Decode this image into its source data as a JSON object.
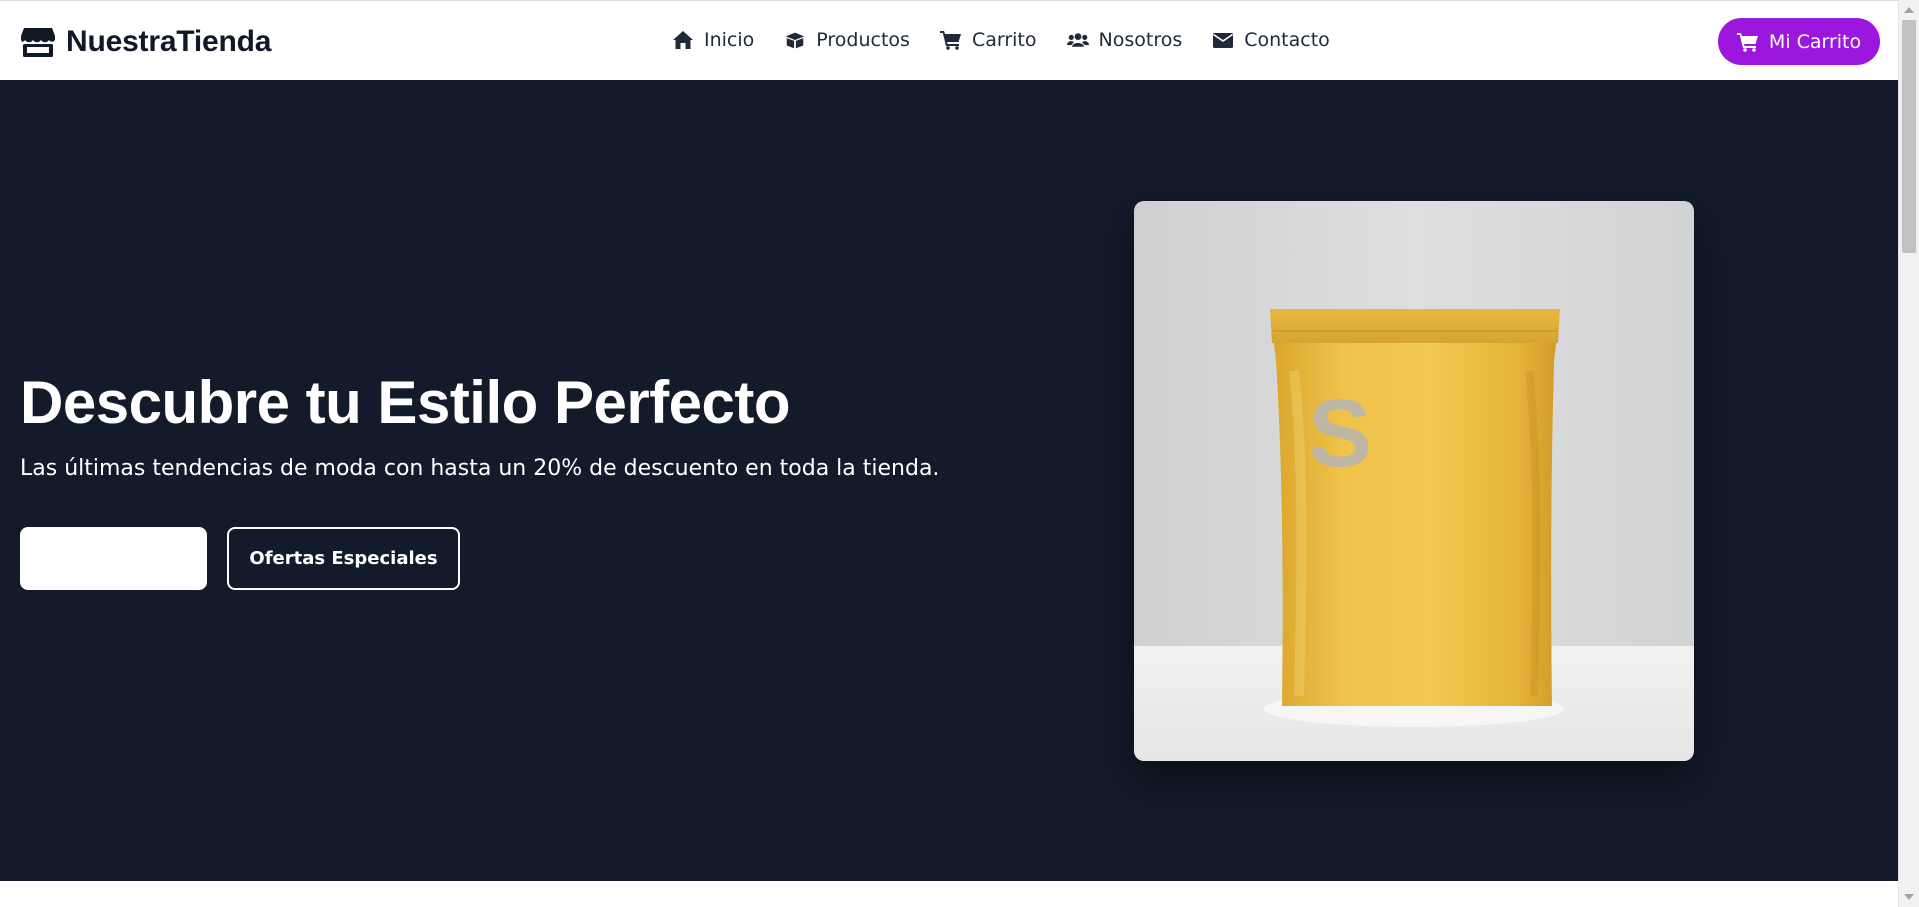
{
  "header": {
    "brand": "NuestraTienda",
    "brand_icon": "store-icon",
    "nav": [
      {
        "label": "Inicio",
        "icon": "home-icon"
      },
      {
        "label": "Productos",
        "icon": "box-icon"
      },
      {
        "label": "Carrito",
        "icon": "cart-icon"
      },
      {
        "label": "Nosotros",
        "icon": "users-icon"
      },
      {
        "label": "Contacto",
        "icon": "envelope-icon"
      }
    ],
    "cart_button": {
      "label": "Mi Carrito",
      "icon": "cart-icon"
    }
  },
  "hero": {
    "title": "Descubre tu Estilo Perfecto",
    "subtitle": "Las últimas tendencias de moda con hasta un 20% de descuento en toda la tienda.",
    "primary_button": "",
    "secondary_button": "Ofertas Especiales",
    "image_subject": "gold pouch with letter S"
  },
  "colors": {
    "accent": "#9b17de",
    "hero_background": "#131a2a",
    "nav_text": "#1f2937"
  }
}
